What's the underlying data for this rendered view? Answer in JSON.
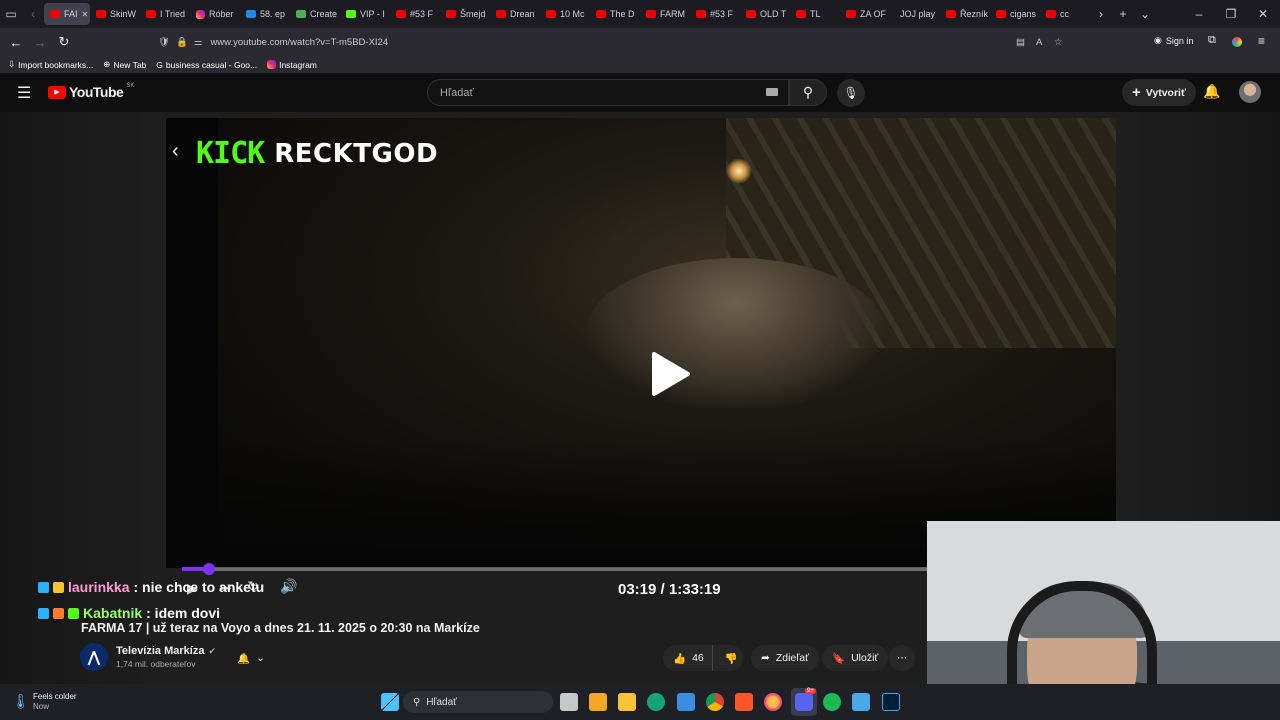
{
  "browser": {
    "tabs": [
      {
        "label": "FAI",
        "icon": "youtube-icon",
        "active": true
      },
      {
        "label": "SkinW",
        "icon": "youtube-icon"
      },
      {
        "label": "I Tried",
        "icon": "youtube-icon"
      },
      {
        "label": "Róber",
        "icon": "instagram-icon"
      },
      {
        "label": "58. ep",
        "icon": "voyo-icon"
      },
      {
        "label": "Create",
        "icon": "create-icon"
      },
      {
        "label": "VIP - I",
        "icon": "kick-icon"
      },
      {
        "label": "#53 F",
        "icon": "youtube-icon"
      },
      {
        "label": "Šmejd",
        "icon": "youtube-icon"
      },
      {
        "label": "Drean",
        "icon": "youtube-icon"
      },
      {
        "label": "10 Mc",
        "icon": "youtube-icon"
      },
      {
        "label": "The D",
        "icon": "youtube-icon"
      },
      {
        "label": "FARM",
        "icon": "youtube-icon"
      },
      {
        "label": "#53 F",
        "icon": "youtube-icon"
      },
      {
        "label": "OLD T",
        "icon": "youtube-icon"
      },
      {
        "label": "TL",
        "icon": "youtube-icon"
      },
      {
        "label": "ZA OF",
        "icon": "youtube-icon"
      },
      {
        "label": "JOJ play",
        "icon": "joj-icon"
      },
      {
        "label": "Řezník",
        "icon": "youtube-icon"
      },
      {
        "label": "cigans",
        "icon": "youtube-icon"
      },
      {
        "label": "cc",
        "icon": "youtube-icon"
      }
    ],
    "url": "www.youtube.com/watch?v=T-m5BD-XI24",
    "sign_in": "Sign in",
    "bookmarks": [
      {
        "label": "Import bookmarks...",
        "icon": "import-icon"
      },
      {
        "label": "New Tab",
        "icon": "globe-icon"
      },
      {
        "label": "business casual - Goo...",
        "icon": "google-icon"
      },
      {
        "label": "Instagram",
        "icon": "instagram-icon"
      }
    ]
  },
  "youtube": {
    "logo_text": "YouTube",
    "region": "SK",
    "search_placeholder": "Hľadať",
    "create_label": "Vytvoriť"
  },
  "player": {
    "overlay_logo": "KICK",
    "overlay_streamer": "RECKTGOD",
    "time_current": "03:19",
    "time_separator": "/",
    "time_total": "1:33:19",
    "progress": 0.036
  },
  "chat": [
    {
      "user": "laurinkka",
      "message": ": nie chce to anketu",
      "user_color": "#ff9bd4"
    },
    {
      "user": "Kabatnik",
      "message": ": idem dovi",
      "user_color": "#9bff6e"
    }
  ],
  "video": {
    "title": "FARMA 17 | už teraz na Voyo a dnes 21. 11. 2025 o 20:30 na Markíze",
    "channel_name": "Televízia Markíza",
    "subscribers": "1,74 mil. odberateľov",
    "likes": "46",
    "share_label": "Zdieľať",
    "save_label": "Uložiť"
  },
  "taskbar": {
    "weather_title": "Feels colder",
    "weather_sub": "Now",
    "search_label": "Hľadať",
    "notification_count": "9+"
  },
  "colors": {
    "kick_green": "#53fc18",
    "progress_purple": "#7d32ff",
    "youtube_red": "#ff0000"
  }
}
